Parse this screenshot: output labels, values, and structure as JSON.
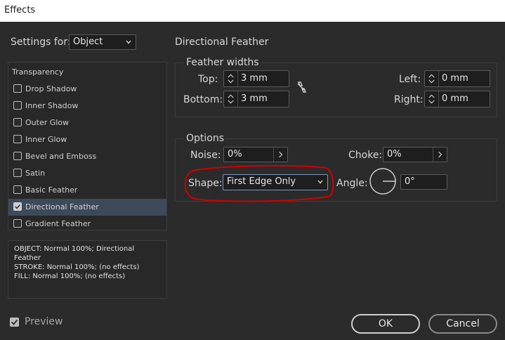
{
  "window": {
    "title": "Effects"
  },
  "settings_for": {
    "label": "Settings for:",
    "value": "Object"
  },
  "effects_list": {
    "header": "Transparency",
    "items": [
      {
        "label": "Drop Shadow",
        "checked": false
      },
      {
        "label": "Inner Shadow",
        "checked": false
      },
      {
        "label": "Outer Glow",
        "checked": false
      },
      {
        "label": "Inner Glow",
        "checked": false
      },
      {
        "label": "Bevel and Emboss",
        "checked": false
      },
      {
        "label": "Satin",
        "checked": false
      },
      {
        "label": "Basic Feather",
        "checked": false
      },
      {
        "label": "Directional Feather",
        "checked": true,
        "selected": true
      },
      {
        "label": "Gradient Feather",
        "checked": false
      }
    ]
  },
  "summary": {
    "line1": "OBJECT: Normal 100%; Directional",
    "line2": "Feather",
    "line3": "STROKE: Normal 100%; (no effects)",
    "line4": "FILL: Normal 100%; (no effects)"
  },
  "panel": {
    "title": "Directional Feather",
    "feather_widths": {
      "label": "Feather widths",
      "top_label": "Top:",
      "top_value": "3 mm",
      "bottom_label": "Bottom:",
      "bottom_value": "3 mm",
      "left_label": "Left:",
      "left_value": "0 mm",
      "right_label": "Right:",
      "right_value": "0 mm",
      "link_icon": "chain-link-broken-icon"
    },
    "options": {
      "label": "Options",
      "noise_label": "Noise:",
      "noise_value": "0%",
      "choke_label": "Choke:",
      "choke_value": "0%",
      "shape_label": "Shape:",
      "shape_value": "First Edge Only",
      "angle_label": "Angle:",
      "angle_value": "0°"
    }
  },
  "preview": {
    "label": "Preview",
    "checked": true
  },
  "buttons": {
    "ok": "OK",
    "cancel": "Cancel"
  },
  "colors": {
    "background": "#2b2b2b",
    "annotation_red": "#d10000",
    "selection": "#3d4a5a"
  }
}
